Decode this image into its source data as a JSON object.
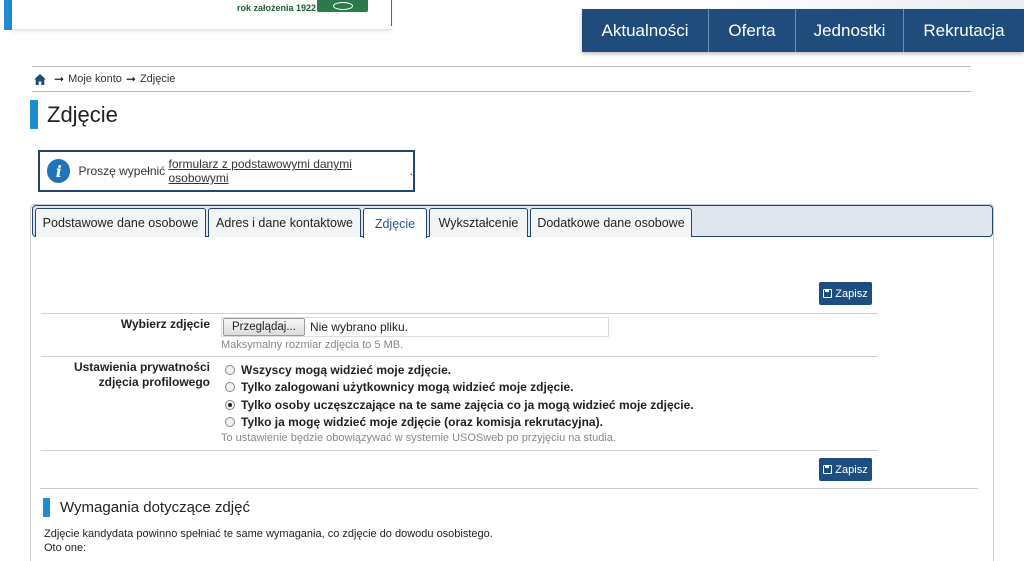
{
  "header": {
    "logo_tagline": "rok założenia 1922",
    "nav": [
      "Aktualności",
      "Oferta",
      "Jednostki",
      "Rekrutacja"
    ]
  },
  "breadcrumb": {
    "home_icon": "home-icon",
    "items": [
      "Moje konto",
      "Zdjęcie"
    ]
  },
  "page_title": "Zdjęcie",
  "info": {
    "icon": "info-icon",
    "prefix": "Proszę wypełnić ",
    "link": "formularz z podstawowymi danymi osobowymi",
    "suffix": "."
  },
  "tabs": [
    {
      "label": "Podstawowe dane osobowe",
      "active": false
    },
    {
      "label": "Adres i dane kontaktowe",
      "active": false
    },
    {
      "label": "Zdjęcie",
      "active": true
    },
    {
      "label": "Wykształcenie",
      "active": false
    },
    {
      "label": "Dodatkowe dane osobowe",
      "active": false
    }
  ],
  "form": {
    "save_label": "Zapisz",
    "photo": {
      "label": "Wybierz zdjęcie",
      "browse_button": "Przeglądaj...",
      "file_status": "Nie wybrano pliku.",
      "hint": "Maksymalny rozmiar zdjęcia to 5 MB."
    },
    "privacy": {
      "label_line1": "Ustawienia prywatności",
      "label_line2": "zdjęcia profilowego",
      "options": [
        {
          "label": "Wszyscy mogą widzieć moje zdjęcie.",
          "checked": false
        },
        {
          "label": "Tylko zalogowani użytkownicy mogą widzieć moje zdjęcie.",
          "checked": false
        },
        {
          "label": "Tylko osoby uczęszczające na te same zajęcia co ja mogą widzieć moje zdjęcie.",
          "checked": true
        },
        {
          "label": "Tylko ja mogę widzieć moje zdjęcie (oraz komisja rekrutacyjna).",
          "checked": false
        }
      ],
      "hint": "To ustawienie będzie obowiązywać w systemie USOSweb po przyjęciu na studia."
    }
  },
  "requirements": {
    "title": "Wymagania dotyczące zdjęć",
    "line1": "Zdjęcie kandydata powinno spełniać te same wymagania, co zdjęcie do dowodu osobistego.",
    "line2": "Oto one:"
  },
  "colors": {
    "accent": "#1e8ed0",
    "nav_bg": "#1f4c7a",
    "button": "#1c4f80"
  }
}
